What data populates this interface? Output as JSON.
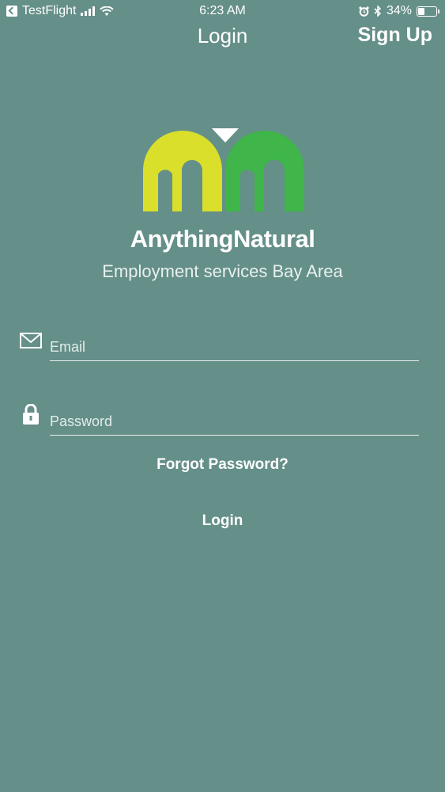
{
  "status_bar": {
    "back_app": "TestFlight",
    "time": "6:23 AM",
    "battery": "34%",
    "battery_level": 0.34
  },
  "nav": {
    "title": "Login",
    "signup_label": "Sign Up"
  },
  "brand": {
    "name": "AnythingNatural",
    "tagline": "Employment services Bay Area",
    "colors": {
      "yellow": "#d9df2b",
      "green": "#3fb54a"
    }
  },
  "form": {
    "email_placeholder": "Email",
    "password_placeholder": "Password",
    "forgot_label": "Forgot Password?",
    "login_label": "Login"
  },
  "icons": [
    "back-icon",
    "signal-icon",
    "wifi-icon",
    "alarm-icon",
    "bluetooth-icon",
    "battery-icon",
    "envelope-icon",
    "lock-icon"
  ]
}
